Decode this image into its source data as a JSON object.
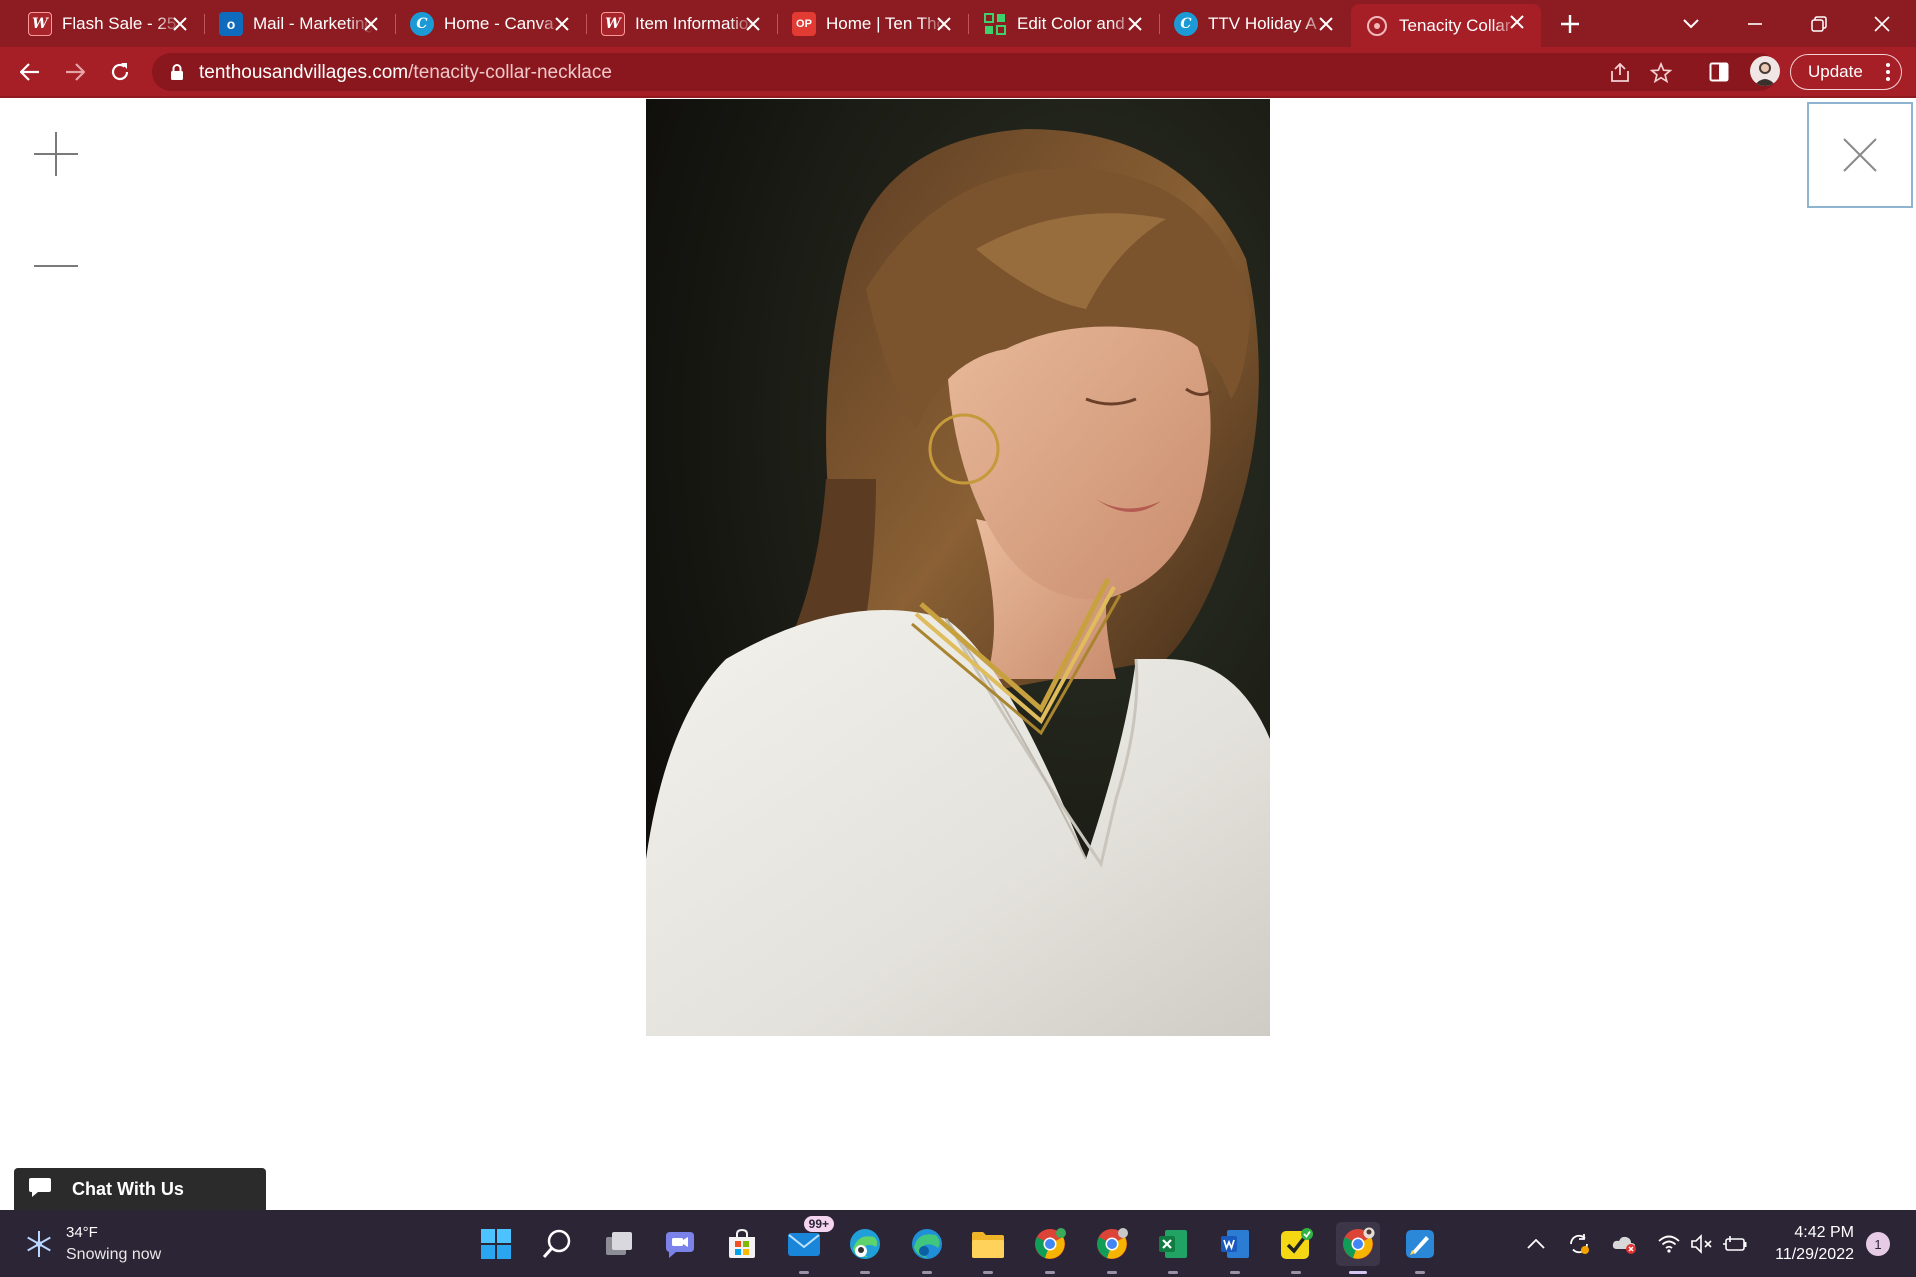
{
  "browser": {
    "tabs": [
      {
        "title": "Flash Sale - 25",
        "favicon": "ten-thousand-villages-w"
      },
      {
        "title": "Mail - Marketing",
        "favicon": "outlook"
      },
      {
        "title": "Home - Canva",
        "favicon": "canva"
      },
      {
        "title": "Item Information",
        "favicon": "ten-thousand-villages-w"
      },
      {
        "title": "Home | Ten Thousand",
        "favicon": "op"
      },
      {
        "title": "Edit Color and",
        "favicon": "grid-app"
      },
      {
        "title": "TTV Holiday A",
        "favicon": "canva"
      },
      {
        "title": "Tenacity Collar",
        "favicon": "ten-thousand-villages",
        "active": true
      }
    ],
    "favicon_letters": {
      "w": "W",
      "outlook": "o",
      "canva": "C",
      "op": "OP"
    },
    "address": {
      "domain": "tenthousandvillages.com",
      "path": "/tenacity-collar-necklace"
    },
    "update_label": "Update"
  },
  "lightbox": {
    "zoom_in": "plus-icon",
    "zoom_out": "minus-icon",
    "close": "close-icon",
    "image_subject": "woman wearing gold chevron collar necklace and white blouse"
  },
  "chat": {
    "label": "Chat With Us"
  },
  "taskbar": {
    "weather": {
      "temp": "34°F",
      "condition": "Snowing now"
    },
    "mail_badge": "99+",
    "clock": {
      "time": "4:42 PM",
      "date": "11/29/2022"
    },
    "notification_count": "1"
  },
  "colors": {
    "browser_frame": "#8c1c22",
    "toolbar": "#a61e26",
    "taskbar": "#2b2535"
  }
}
